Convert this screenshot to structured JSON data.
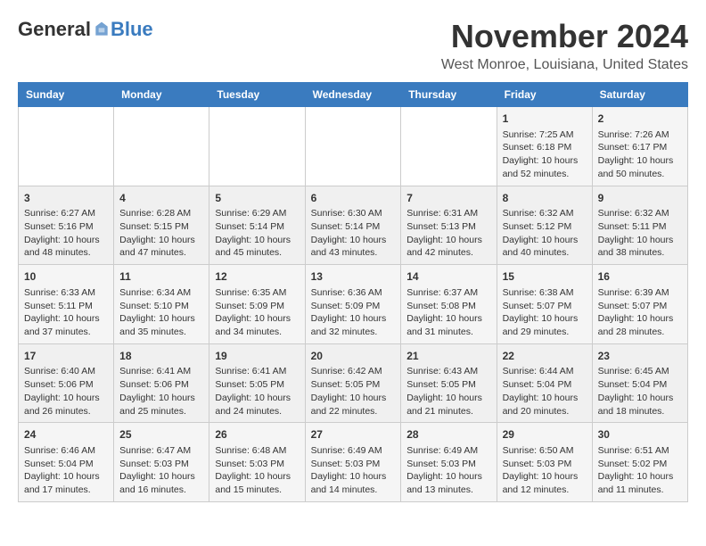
{
  "header": {
    "logo_general": "General",
    "logo_blue": "Blue",
    "month": "November 2024",
    "location": "West Monroe, Louisiana, United States"
  },
  "columns": [
    "Sunday",
    "Monday",
    "Tuesday",
    "Wednesday",
    "Thursday",
    "Friday",
    "Saturday"
  ],
  "weeks": [
    [
      {
        "day": "",
        "info": ""
      },
      {
        "day": "",
        "info": ""
      },
      {
        "day": "",
        "info": ""
      },
      {
        "day": "",
        "info": ""
      },
      {
        "day": "",
        "info": ""
      },
      {
        "day": "1",
        "info": "Sunrise: 7:25 AM\nSunset: 6:18 PM\nDaylight: 10 hours and 52 minutes."
      },
      {
        "day": "2",
        "info": "Sunrise: 7:26 AM\nSunset: 6:17 PM\nDaylight: 10 hours and 50 minutes."
      }
    ],
    [
      {
        "day": "3",
        "info": "Sunrise: 6:27 AM\nSunset: 5:16 PM\nDaylight: 10 hours and 48 minutes."
      },
      {
        "day": "4",
        "info": "Sunrise: 6:28 AM\nSunset: 5:15 PM\nDaylight: 10 hours and 47 minutes."
      },
      {
        "day": "5",
        "info": "Sunrise: 6:29 AM\nSunset: 5:14 PM\nDaylight: 10 hours and 45 minutes."
      },
      {
        "day": "6",
        "info": "Sunrise: 6:30 AM\nSunset: 5:14 PM\nDaylight: 10 hours and 43 minutes."
      },
      {
        "day": "7",
        "info": "Sunrise: 6:31 AM\nSunset: 5:13 PM\nDaylight: 10 hours and 42 minutes."
      },
      {
        "day": "8",
        "info": "Sunrise: 6:32 AM\nSunset: 5:12 PM\nDaylight: 10 hours and 40 minutes."
      },
      {
        "day": "9",
        "info": "Sunrise: 6:32 AM\nSunset: 5:11 PM\nDaylight: 10 hours and 38 minutes."
      }
    ],
    [
      {
        "day": "10",
        "info": "Sunrise: 6:33 AM\nSunset: 5:11 PM\nDaylight: 10 hours and 37 minutes."
      },
      {
        "day": "11",
        "info": "Sunrise: 6:34 AM\nSunset: 5:10 PM\nDaylight: 10 hours and 35 minutes."
      },
      {
        "day": "12",
        "info": "Sunrise: 6:35 AM\nSunset: 5:09 PM\nDaylight: 10 hours and 34 minutes."
      },
      {
        "day": "13",
        "info": "Sunrise: 6:36 AM\nSunset: 5:09 PM\nDaylight: 10 hours and 32 minutes."
      },
      {
        "day": "14",
        "info": "Sunrise: 6:37 AM\nSunset: 5:08 PM\nDaylight: 10 hours and 31 minutes."
      },
      {
        "day": "15",
        "info": "Sunrise: 6:38 AM\nSunset: 5:07 PM\nDaylight: 10 hours and 29 minutes."
      },
      {
        "day": "16",
        "info": "Sunrise: 6:39 AM\nSunset: 5:07 PM\nDaylight: 10 hours and 28 minutes."
      }
    ],
    [
      {
        "day": "17",
        "info": "Sunrise: 6:40 AM\nSunset: 5:06 PM\nDaylight: 10 hours and 26 minutes."
      },
      {
        "day": "18",
        "info": "Sunrise: 6:41 AM\nSunset: 5:06 PM\nDaylight: 10 hours and 25 minutes."
      },
      {
        "day": "19",
        "info": "Sunrise: 6:41 AM\nSunset: 5:05 PM\nDaylight: 10 hours and 24 minutes."
      },
      {
        "day": "20",
        "info": "Sunrise: 6:42 AM\nSunset: 5:05 PM\nDaylight: 10 hours and 22 minutes."
      },
      {
        "day": "21",
        "info": "Sunrise: 6:43 AM\nSunset: 5:05 PM\nDaylight: 10 hours and 21 minutes."
      },
      {
        "day": "22",
        "info": "Sunrise: 6:44 AM\nSunset: 5:04 PM\nDaylight: 10 hours and 20 minutes."
      },
      {
        "day": "23",
        "info": "Sunrise: 6:45 AM\nSunset: 5:04 PM\nDaylight: 10 hours and 18 minutes."
      }
    ],
    [
      {
        "day": "24",
        "info": "Sunrise: 6:46 AM\nSunset: 5:04 PM\nDaylight: 10 hours and 17 minutes."
      },
      {
        "day": "25",
        "info": "Sunrise: 6:47 AM\nSunset: 5:03 PM\nDaylight: 10 hours and 16 minutes."
      },
      {
        "day": "26",
        "info": "Sunrise: 6:48 AM\nSunset: 5:03 PM\nDaylight: 10 hours and 15 minutes."
      },
      {
        "day": "27",
        "info": "Sunrise: 6:49 AM\nSunset: 5:03 PM\nDaylight: 10 hours and 14 minutes."
      },
      {
        "day": "28",
        "info": "Sunrise: 6:49 AM\nSunset: 5:03 PM\nDaylight: 10 hours and 13 minutes."
      },
      {
        "day": "29",
        "info": "Sunrise: 6:50 AM\nSunset: 5:03 PM\nDaylight: 10 hours and 12 minutes."
      },
      {
        "day": "30",
        "info": "Sunrise: 6:51 AM\nSunset: 5:02 PM\nDaylight: 10 hours and 11 minutes."
      }
    ]
  ]
}
